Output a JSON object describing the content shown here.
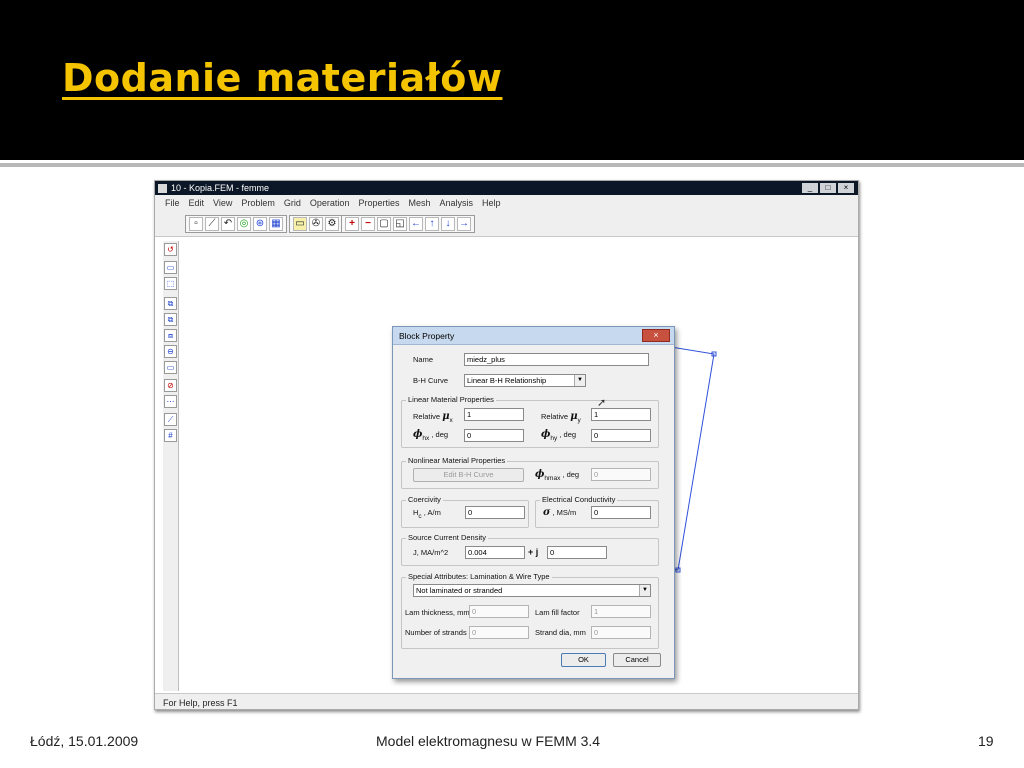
{
  "slide": {
    "title": "Dodanie materiałów",
    "footer_left": "Łódź, 15.01.2009",
    "footer_center": "Model elektromagnesu w FEMM 3.4",
    "footer_right": "19"
  },
  "app": {
    "title": "10 - Kopia.FEM - femme",
    "window_buttons": [
      "_",
      "□",
      "×"
    ],
    "menu": [
      "File",
      "Edit",
      "View",
      "Problem",
      "Grid",
      "Operation",
      "Properties",
      "Mesh",
      "Analysis",
      "Help"
    ],
    "status": "For Help, press F1"
  },
  "dialog": {
    "title": "Block Property",
    "close": "×",
    "name_label": "Name",
    "name_value": "miedz_plus",
    "bh_label": "B-H Curve",
    "bh_value": "Linear B-H Relationship",
    "linear": {
      "title": "Linear Material Properties",
      "relative": "Relative",
      "mu": "μ",
      "x_sub": "x",
      "y_sub": "y",
      "mu_x": "1",
      "mu_y": "1",
      "phi": "ϕ",
      "hx_sub": "hx",
      "hy_sub": "hy",
      "deg": ", deg",
      "phi_hx": "0",
      "phi_hy": "0"
    },
    "nonlinear": {
      "title": "Nonlinear Material Properties",
      "edit_button": "Edit B-H Curve",
      "phi": "ϕ",
      "hmax_sub": "hmax",
      "deg": ", deg",
      "phi_hmax": "0"
    },
    "coercivity": {
      "title": "Coercivity",
      "h": "H",
      "c_sub": "c",
      "unit": ", A/m",
      "value": "0"
    },
    "conductivity": {
      "title": "Electrical Conductivity",
      "sigma": "σ",
      "unit": ", MS/m",
      "value": "0"
    },
    "source": {
      "title": "Source Current Density",
      "label": "J, MA/m^2",
      "real": "0.004",
      "plus_j": "+ j",
      "imag": "0"
    },
    "special": {
      "title": "Special Attributes:  Lamination & Wire Type",
      "lam_value": "Not laminated or stranded",
      "lam_thickness_label": "Lam thickness, mm",
      "lam_thickness": "0",
      "lam_fill_label": "Lam fill factor",
      "lam_fill": "1",
      "strands_label": "Number of strands",
      "strands": "0",
      "strand_dia_label": "Strand dia, mm",
      "strand_dia": "0"
    },
    "ok": "OK",
    "cancel": "Cancel"
  },
  "icons": {
    "selection_icons": [
      "pointer-icon",
      "node-icon",
      "segment-icon",
      "arc-icon",
      "block-label-icon",
      "group-icon",
      "table-icon"
    ],
    "nav_icons": [
      "plus-icon",
      "minus-icon",
      "page-icon",
      "zoom-window-icon",
      "arrow-left-icon",
      "arrow-up-icon",
      "arrow-down-icon",
      "arrow-right-icon"
    ]
  }
}
